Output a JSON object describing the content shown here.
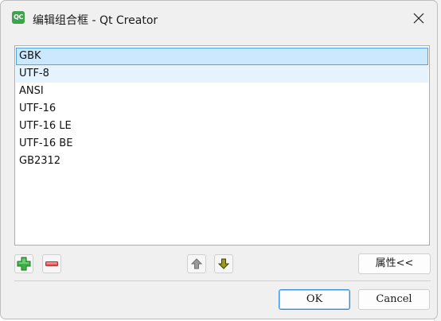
{
  "window": {
    "title": "编辑组合框 - Qt Creator",
    "icon_label": "QC",
    "icon_name": "qt-creator-icon",
    "close_icon": "close-icon"
  },
  "list": {
    "items": [
      {
        "label": "GBK",
        "state": "selected"
      },
      {
        "label": "UTF-8",
        "state": "hover"
      },
      {
        "label": "ANSI",
        "state": "normal"
      },
      {
        "label": "UTF-16",
        "state": "normal"
      },
      {
        "label": "UTF-16 LE",
        "state": "normal"
      },
      {
        "label": "UTF-16 BE",
        "state": "normal"
      },
      {
        "label": "GB2312",
        "state": "normal"
      }
    ]
  },
  "toolbar": {
    "add_icon": "plus-icon",
    "remove_icon": "minus-icon",
    "move_up_icon": "arrow-up-icon",
    "move_down_icon": "arrow-down-icon",
    "properties_label": "属性<<"
  },
  "buttons": {
    "ok_label": "OK",
    "cancel_label": "Cancel"
  },
  "colors": {
    "selection_bg": "#cce8ff",
    "selection_border": "#4ea4e6",
    "hover_bg": "#e5f3ff",
    "add_green": "#3cb043",
    "remove_red": "#e06060",
    "qt_green": "#3fa34d"
  }
}
